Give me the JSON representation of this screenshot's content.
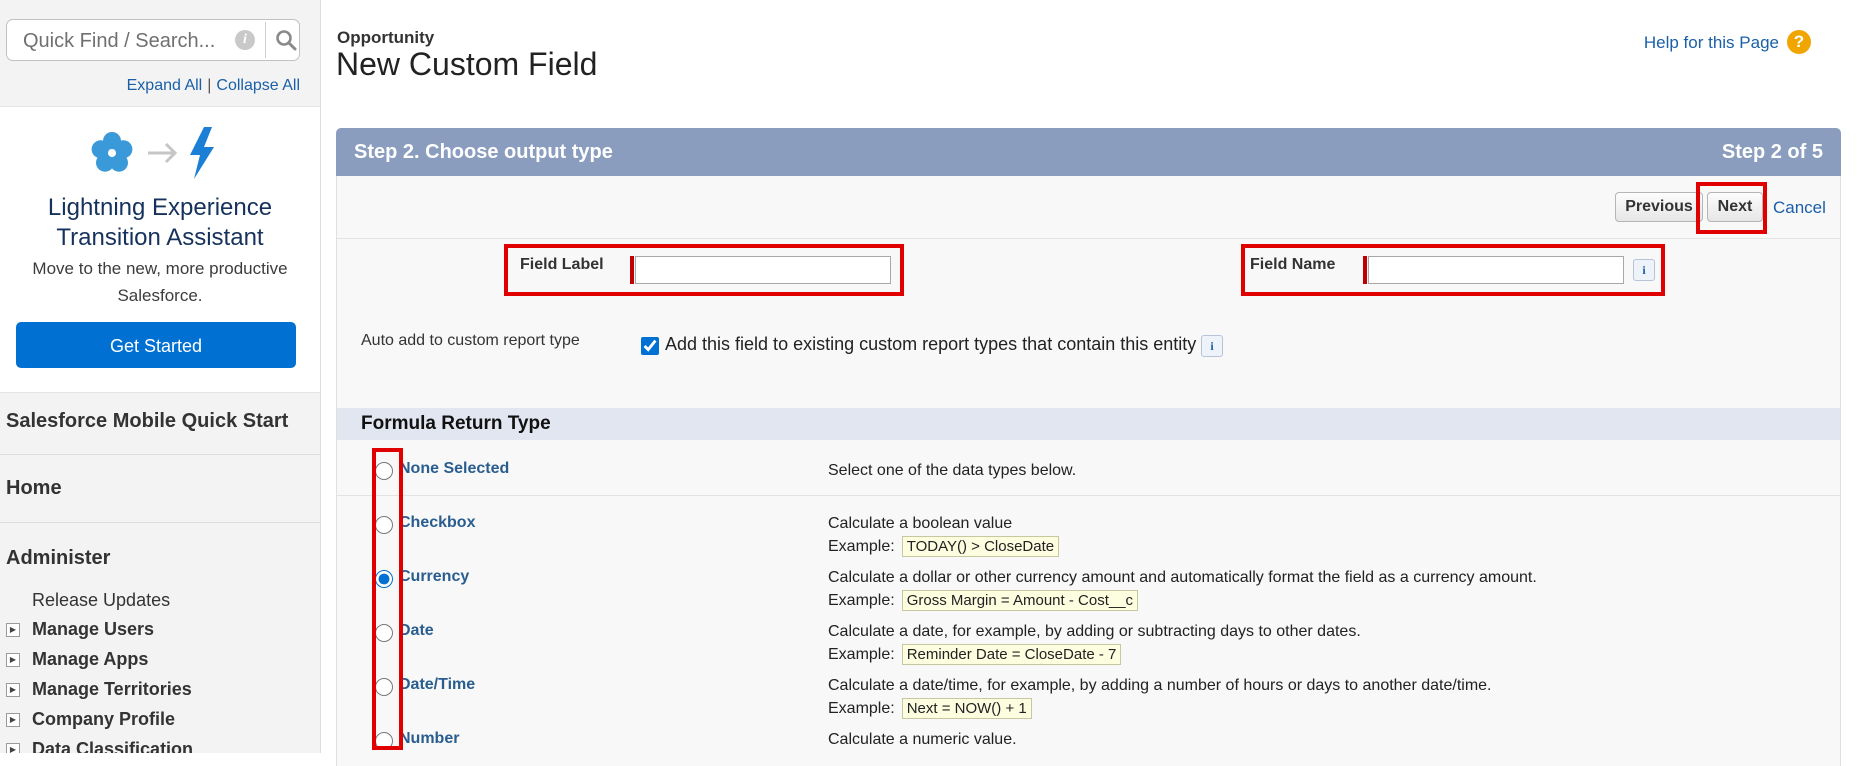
{
  "sidebar": {
    "search": {
      "placeholder": "Quick Find / Search..."
    },
    "expand_all": "Expand All",
    "separator": "|",
    "collapse_all": "Collapse All",
    "promo": {
      "title": "Lightning Experience Transition Assistant",
      "text": "Move to the new, more productive Salesforce.",
      "button": "Get Started"
    },
    "mobile_quick_start": "Salesforce Mobile Quick Start",
    "home": "Home",
    "administer": {
      "label": "Administer",
      "release_updates": "Release Updates",
      "items": [
        {
          "label": "Manage Users"
        },
        {
          "label": "Manage Apps"
        },
        {
          "label": "Manage Territories"
        },
        {
          "label": "Company Profile"
        },
        {
          "label": "Data Classification"
        }
      ]
    }
  },
  "header": {
    "object": "Opportunity",
    "title": "New Custom Field",
    "help_link": "Help for this Page",
    "help_icon": "?"
  },
  "wizard": {
    "step_title": "Step 2. Choose output type",
    "step_count": "Step 2 of 5",
    "buttons": {
      "previous": "Previous",
      "next": "Next",
      "cancel": "Cancel"
    },
    "field_label": {
      "label": "Field Label",
      "value": ""
    },
    "field_name": {
      "label": "Field Name",
      "value": ""
    },
    "auto_add": {
      "label": "Auto add to custom report type",
      "checkbox_text": "Add this field to existing custom report types that contain this entity",
      "checked": true
    },
    "info_glyph": "i",
    "example_label": "Example:"
  },
  "formula_return_type": {
    "heading": "Formula Return Type",
    "selected": "Currency",
    "options": [
      {
        "name": "None Selected",
        "description": "Select one of the data types below.",
        "example": ""
      },
      {
        "name": "Checkbox",
        "description": "Calculate a boolean value",
        "example": "TODAY() > CloseDate"
      },
      {
        "name": "Currency",
        "description": "Calculate a dollar or other currency amount and automatically format the field as a currency amount.",
        "example": "Gross Margin = Amount - Cost__c"
      },
      {
        "name": "Date",
        "description": "Calculate a date, for example, by adding or subtracting days to other dates.",
        "example": "Reminder Date = CloseDate - 7"
      },
      {
        "name": "Date/Time",
        "description": "Calculate a date/time, for example, by adding a number of hours or days to another date/time.",
        "example": "Next = NOW() + 1"
      },
      {
        "name": "Number",
        "description": "Calculate a numeric value.",
        "example": ""
      }
    ]
  },
  "icons": {
    "search": "magnifier-icon",
    "info": "info-icon",
    "flower": "salesforce-flower-icon",
    "arrow": "arrow-right-icon",
    "bolt": "lightning-bolt-icon",
    "expand": "plus-box-icon"
  },
  "colors": {
    "accent": "#0070d2",
    "step_bar": "#8a9dbf",
    "highlight": "#e00000",
    "required": "#c00000",
    "help": "#f0a500"
  }
}
